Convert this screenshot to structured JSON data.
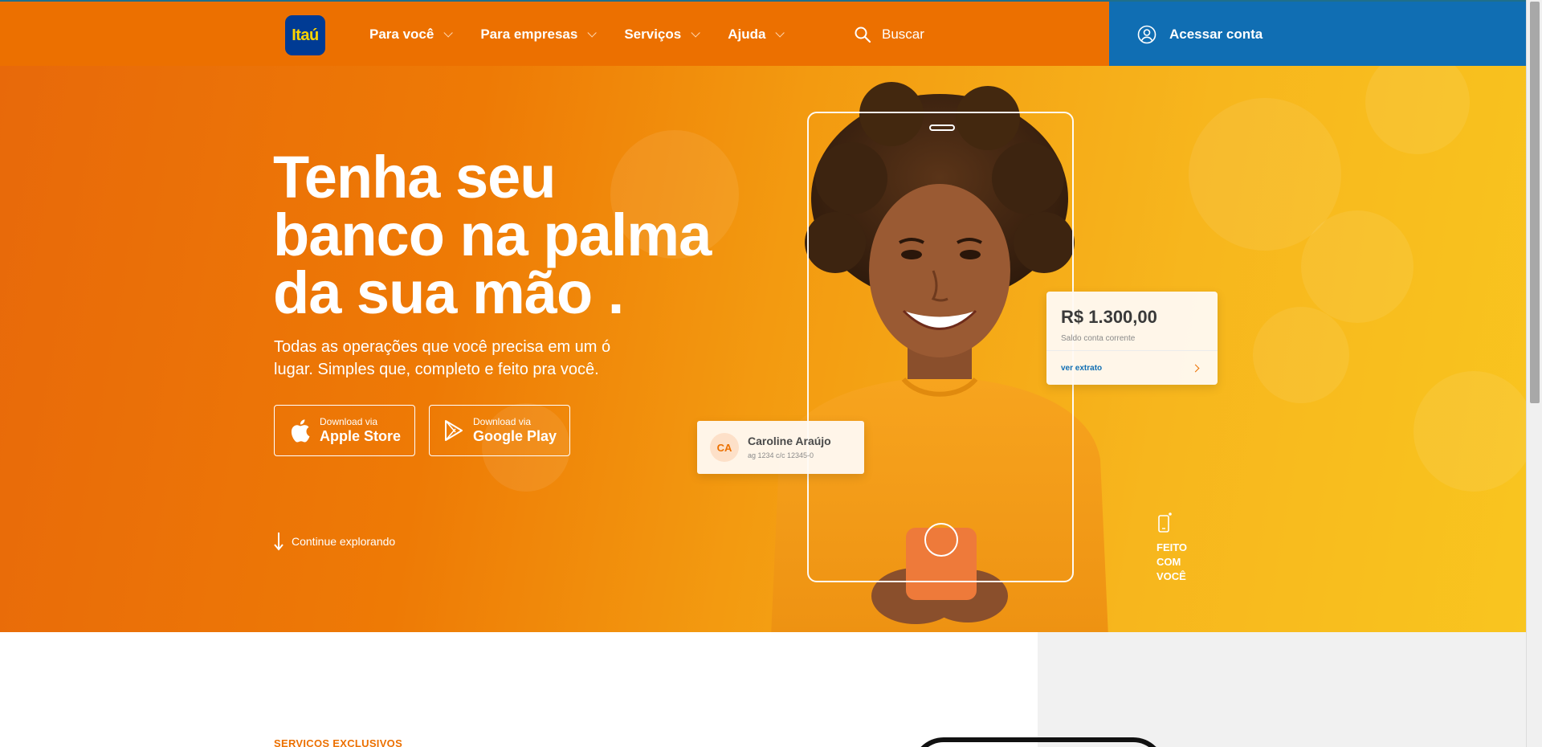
{
  "header": {
    "logo_text": "Itaú",
    "nav": [
      {
        "label": "Para você"
      },
      {
        "label": "Para empresas"
      },
      {
        "label": "Serviços"
      },
      {
        "label": "Ajuda"
      }
    ],
    "search_label": "Buscar",
    "login_label": "Acessar conta"
  },
  "hero": {
    "title_lines": [
      "Tenha seu",
      "banco na palma",
      "da sua mão ."
    ],
    "subtitle_lines": [
      "Todas as operações que você precisa em um ó",
      "lugar. Simples que, completo e feito pra você."
    ],
    "apple": {
      "small": "Download via",
      "big": "Apple Store"
    },
    "google": {
      "small": "Download via",
      "big": "Google Play"
    },
    "explore_label": "Continue explorando",
    "balance": {
      "amount": "R$ 1.300,00",
      "label": "Saldo conta corrente",
      "link": "ver extrato"
    },
    "user": {
      "initials": "CA",
      "name": "Caroline Araújo",
      "account": "ag 1234  c/c 12345-0"
    },
    "badge_lines": [
      "FEITO",
      "COM",
      "VOCÊ"
    ]
  },
  "section": {
    "label": "SERVIÇOS EXCLUSIVOS"
  },
  "colors": {
    "brand_orange": "#ec7000",
    "brand_blue": "#106eb3",
    "logo_blue": "#003b94",
    "logo_yellow": "#ffd500"
  }
}
